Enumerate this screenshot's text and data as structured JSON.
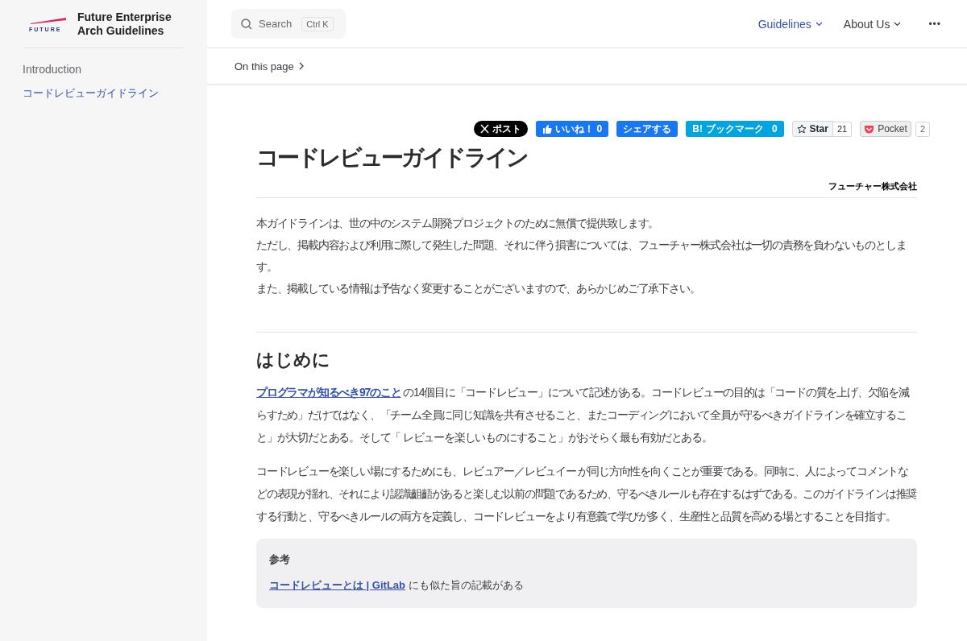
{
  "sidebar": {
    "logo_text": "FUTURE",
    "site_title": "Future Enterprise Arch Guidelines",
    "items": [
      {
        "label": "Introduction",
        "selected": false
      },
      {
        "label": "コードレビューガイドライン",
        "selected": true
      }
    ]
  },
  "topbar": {
    "search": {
      "placeholder": "Search",
      "shortcut": "Ctrl K"
    },
    "nav": [
      {
        "label": "Guidelines",
        "selected": true
      },
      {
        "label": "About Us",
        "selected": false
      }
    ],
    "more": "•••"
  },
  "local_nav": {
    "label": "On this page"
  },
  "share": [
    {
      "kind": "x",
      "label": "ポスト"
    },
    {
      "kind": "like",
      "label": "いいね！",
      "count": "0"
    },
    {
      "kind": "share",
      "label": "シェアする"
    },
    {
      "kind": "hatena",
      "label": "ブックマーク",
      "icon_text": "B!",
      "count": "0"
    },
    {
      "kind": "star",
      "label": "Star",
      "count": "21"
    },
    {
      "kind": "pocket",
      "label": "Pocket",
      "count": "2"
    }
  ],
  "article": {
    "title": "コードレビューガイドライン",
    "author": "フューチャー株式会社",
    "notice": [
      "本ガイドラインは、世の中のシステム開発プロジェクトのために無償で提供致します。",
      "ただし、掲載内容および利用に際して発生した問題、それに伴う損害については、フューチャー株式会社は一切の責務を負わないものとします。",
      "また、掲載している情報は予告なく変更することがございますので、あらかじめご了承下さい。"
    ],
    "sections": [
      {
        "heading": "はじめに",
        "paragraphs": [
          {
            "link": "プログラマが知るべき97のこと",
            "text": " の14個目に「コードレビュー」について記述がある。コードレビューの目的は「コードの質を上げ、欠陥を減らすため」だけではなく、「チーム全員に同じ知識を共有させること、またコーディングにおいて全員が守るべきガイドラインを確立すること」が大切だとある。そして「 レビューを楽しいものにすること」がおそらく最も有効だとある。"
          },
          {
            "text": "コードレビューを楽しい場にするためにも、レビュアー／レビュイー が同じ方向性を向くことが重要である。同時に、人によってコメントなどの表現が揺れ、それにより認識齟齬があると楽しむ以前の問題であるため、守るべきルールも存在するはずである。このガイドラインは推奨する行動と、守るべきルールの両方を定義し、コードレビューをより有意義で学びが多く、生産性と品質を高める場とすることを目指す。"
          }
        ],
        "callout": {
          "title": "参考",
          "link": "コードレビューとは | GitLab",
          "text": " にも似た旨の記載がある"
        }
      }
    ]
  }
}
